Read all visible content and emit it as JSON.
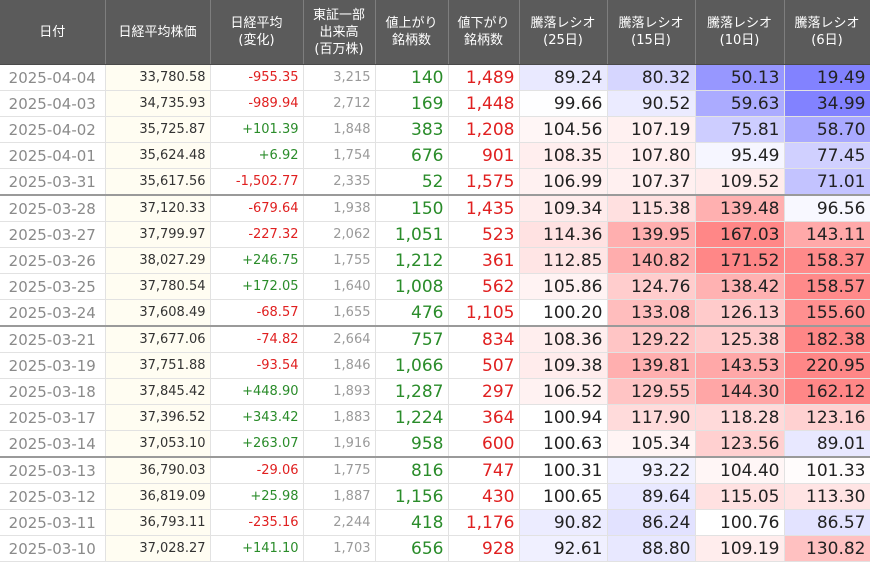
{
  "headers": [
    {
      "l1": "日付",
      "l2": "",
      "l3": ""
    },
    {
      "l1": "日経平均株価",
      "l2": "",
      "l3": ""
    },
    {
      "l1": "日経平均",
      "l2": "(変化)",
      "l3": ""
    },
    {
      "l1": "東証一部",
      "l2": "出来高",
      "l3": "(百万株)"
    },
    {
      "l1": "値上がり",
      "l2": "銘柄数",
      "l3": ""
    },
    {
      "l1": "値下がり",
      "l2": "銘柄数",
      "l3": ""
    },
    {
      "l1": "騰落レシオ",
      "l2": "(25日)",
      "l3": ""
    },
    {
      "l1": "騰落レシオ",
      "l2": "(15日)",
      "l3": ""
    },
    {
      "l1": "騰落レシオ",
      "l2": "(10日)",
      "l3": ""
    },
    {
      "l1": "騰落レシオ",
      "l2": "(6日)",
      "l3": ""
    }
  ],
  "rows": [
    {
      "date": "2025-04-04",
      "price": "33,780.58",
      "change": "-955.35",
      "volume": "3,215",
      "advancers": "140",
      "decliners": "1,489",
      "r25": "89.24",
      "r15": "80.32",
      "r10": "50.13",
      "r6": "19.49",
      "weekEnd": false
    },
    {
      "date": "2025-04-03",
      "price": "34,735.93",
      "change": "-989.94",
      "volume": "2,712",
      "advancers": "169",
      "decliners": "1,448",
      "r25": "99.66",
      "r15": "90.52",
      "r10": "59.63",
      "r6": "34.99",
      "weekEnd": false
    },
    {
      "date": "2025-04-02",
      "price": "35,725.87",
      "change": "+101.39",
      "volume": "1,848",
      "advancers": "383",
      "decliners": "1,208",
      "r25": "104.56",
      "r15": "107.19",
      "r10": "75.81",
      "r6": "58.70",
      "weekEnd": false
    },
    {
      "date": "2025-04-01",
      "price": "35,624.48",
      "change": "+6.92",
      "volume": "1,754",
      "advancers": "676",
      "decliners": "901",
      "r25": "108.35",
      "r15": "107.80",
      "r10": "95.49",
      "r6": "77.45",
      "weekEnd": false
    },
    {
      "date": "2025-03-31",
      "price": "35,617.56",
      "change": "-1,502.77",
      "volume": "2,335",
      "advancers": "52",
      "decliners": "1,575",
      "r25": "106.99",
      "r15": "107.37",
      "r10": "109.52",
      "r6": "71.01",
      "weekEnd": true
    },
    {
      "date": "2025-03-28",
      "price": "37,120.33",
      "change": "-679.64",
      "volume": "1,938",
      "advancers": "150",
      "decliners": "1,435",
      "r25": "109.34",
      "r15": "115.38",
      "r10": "139.48",
      "r6": "96.56",
      "weekEnd": false
    },
    {
      "date": "2025-03-27",
      "price": "37,799.97",
      "change": "-227.32",
      "volume": "2,062",
      "advancers": "1,051",
      "decliners": "523",
      "r25": "114.36",
      "r15": "139.95",
      "r10": "167.03",
      "r6": "143.11",
      "weekEnd": false
    },
    {
      "date": "2025-03-26",
      "price": "38,027.29",
      "change": "+246.75",
      "volume": "1,755",
      "advancers": "1,212",
      "decliners": "361",
      "r25": "112.85",
      "r15": "140.82",
      "r10": "171.52",
      "r6": "158.37",
      "weekEnd": false
    },
    {
      "date": "2025-03-25",
      "price": "37,780.54",
      "change": "+172.05",
      "volume": "1,640",
      "advancers": "1,008",
      "decliners": "562",
      "r25": "105.86",
      "r15": "124.76",
      "r10": "138.42",
      "r6": "158.57",
      "weekEnd": false
    },
    {
      "date": "2025-03-24",
      "price": "37,608.49",
      "change": "-68.57",
      "volume": "1,655",
      "advancers": "476",
      "decliners": "1,105",
      "r25": "100.20",
      "r15": "133.08",
      "r10": "126.13",
      "r6": "155.60",
      "weekEnd": true
    },
    {
      "date": "2025-03-21",
      "price": "37,677.06",
      "change": "-74.82",
      "volume": "2,664",
      "advancers": "757",
      "decliners": "834",
      "r25": "108.36",
      "r15": "129.22",
      "r10": "125.38",
      "r6": "182.38",
      "weekEnd": false
    },
    {
      "date": "2025-03-19",
      "price": "37,751.88",
      "change": "-93.54",
      "volume": "1,846",
      "advancers": "1,066",
      "decliners": "507",
      "r25": "109.38",
      "r15": "139.81",
      "r10": "143.53",
      "r6": "220.95",
      "weekEnd": false
    },
    {
      "date": "2025-03-18",
      "price": "37,845.42",
      "change": "+448.90",
      "volume": "1,893",
      "advancers": "1,287",
      "decliners": "297",
      "r25": "106.52",
      "r15": "129.55",
      "r10": "144.30",
      "r6": "162.12",
      "weekEnd": false
    },
    {
      "date": "2025-03-17",
      "price": "37,396.52",
      "change": "+343.42",
      "volume": "1,883",
      "advancers": "1,224",
      "decliners": "364",
      "r25": "100.94",
      "r15": "117.90",
      "r10": "118.28",
      "r6": "123.16",
      "weekEnd": false
    },
    {
      "date": "2025-03-14",
      "price": "37,053.10",
      "change": "+263.07",
      "volume": "1,916",
      "advancers": "958",
      "decliners": "600",
      "r25": "100.63",
      "r15": "105.34",
      "r10": "123.56",
      "r6": "89.01",
      "weekEnd": true
    },
    {
      "date": "2025-03-13",
      "price": "36,790.03",
      "change": "-29.06",
      "volume": "1,775",
      "advancers": "816",
      "decliners": "747",
      "r25": "100.31",
      "r15": "93.22",
      "r10": "104.40",
      "r6": "101.33",
      "weekEnd": false
    },
    {
      "date": "2025-03-12",
      "price": "36,819.09",
      "change": "+25.98",
      "volume": "1,887",
      "advancers": "1,156",
      "decliners": "430",
      "r25": "100.65",
      "r15": "89.64",
      "r10": "115.05",
      "r6": "113.30",
      "weekEnd": false
    },
    {
      "date": "2025-03-11",
      "price": "36,793.11",
      "change": "-235.16",
      "volume": "2,244",
      "advancers": "418",
      "decliners": "1,176",
      "r25": "90.82",
      "r15": "86.24",
      "r10": "100.76",
      "r6": "86.57",
      "weekEnd": false
    },
    {
      "date": "2025-03-10",
      "price": "37,028.27",
      "change": "+141.10",
      "volume": "1,703",
      "advancers": "656",
      "decliners": "928",
      "r25": "92.61",
      "r15": "88.80",
      "r10": "109.19",
      "r6": "130.82",
      "weekEnd": false
    }
  ]
}
